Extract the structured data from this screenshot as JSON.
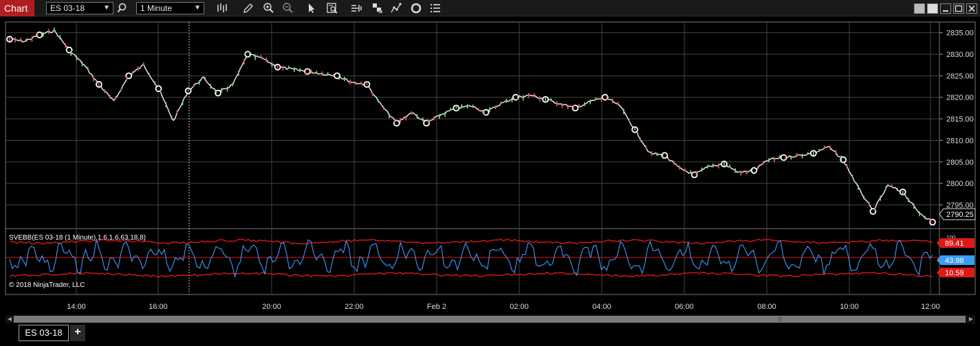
{
  "toolbar": {
    "chart_tab_label": "Chart",
    "instrument": "ES 03-18",
    "interval": "1 Minute",
    "icons": [
      "search-icon",
      "bar-type-icon",
      "pencil-draw-icon",
      "zoom-in-icon",
      "zoom-out-icon",
      "pointer-icon",
      "data-box-icon",
      "strategy-icon",
      "chart-style-icon",
      "drawing-objects-icon",
      "refresh-icon",
      "properties-list-icon"
    ],
    "window_buttons": [
      "window-tile-icon",
      "window-restore-icon",
      "minimize-icon",
      "maximize-icon",
      "close-icon"
    ]
  },
  "price_panel": {
    "y_ticks": [
      "2835.00",
      "2830.00",
      "2825.00",
      "2820.00",
      "2815.00",
      "2810.00",
      "2805.00",
      "2800.00",
      "2795.00"
    ],
    "last_price": "2790.25"
  },
  "indicator_panel": {
    "label": "SVEBB(ES 03-18 (1 Minute),1.6,1.6,63,18,8)",
    "copyright": "© 2018 NinjaTrader, LLC",
    "upper_value": "89.41",
    "mid_value": "43.98",
    "lower_value": "10.59",
    "y_ticks_partial": [
      "100",
      "50",
      "0"
    ]
  },
  "time_axis": {
    "labels": [
      "14:00",
      "16:00",
      "20:00",
      "22:00",
      "Feb 2",
      "02:00",
      "04:00",
      "06:00",
      "08:00",
      "10:00",
      "12:00"
    ]
  },
  "colors": {
    "price_line": "#ffffff",
    "band_color": "#e01818",
    "osc_color": "#3b8fe8",
    "mid_badge": "#3b9cf5",
    "chart_tab": "#b01f1f"
  },
  "chart_data": {
    "type": "line",
    "x": [
      "13:00",
      "13:15",
      "13:30",
      "13:45",
      "14:00",
      "14:15",
      "14:30",
      "14:45",
      "15:00",
      "15:15",
      "15:30",
      "15:45",
      "16:00",
      "16:15",
      "16:30",
      "16:45",
      "17:00",
      "17:15",
      "17:30",
      "17:45",
      "18:00",
      "18:30",
      "19:00",
      "19:30",
      "20:00",
      "20:30",
      "20:45",
      "21:00",
      "21:30",
      "22:00",
      "22:30",
      "23:00",
      "23:30",
      "00:00",
      "00:30",
      "01:00",
      "01:30",
      "02:00",
      "02:30",
      "03:00",
      "03:30",
      "04:00",
      "04:30",
      "05:00",
      "05:30",
      "06:00",
      "06:30",
      "07:00",
      "07:30",
      "08:00",
      "08:30",
      "08:45",
      "09:00",
      "09:30",
      "10:00",
      "10:15",
      "10:30",
      "11:00",
      "11:30",
      "12:00"
    ],
    "series": [
      {
        "values": [
          2833.5,
          2833.0,
          2834.5,
          2835.5,
          2831.0,
          2827.5,
          2823.0,
          2819.0,
          2825.0,
          2827.5,
          2822.0,
          2814.5,
          2821.5,
          2824.5,
          2821.0,
          2823.0,
          2830.0,
          2829.0,
          2827.0,
          2826.5,
          2826.0,
          2825.5,
          2825.0,
          2823.5,
          2823.0,
          2818.0,
          2814.0,
          2816.5,
          2814.0,
          2816.0,
          2817.5,
          2818.0,
          2816.5,
          2818.5,
          2820.0,
          2820.5,
          2819.5,
          2818.5,
          2817.5,
          2819.0,
          2820.0,
          2818.0,
          2812.5,
          2807.0,
          2806.5,
          2803.5,
          2802.0,
          2804.0,
          2804.5,
          2802.5,
          2803.0,
          2805.5,
          2806.0,
          2806.5,
          2807.0,
          2808.5,
          2805.5,
          2799.0,
          2793.5,
          2799.5,
          2798.0,
          2793.5,
          2791.0
        ]
      }
    ],
    "y_ticks": [
      "2835.00",
      "2830.00",
      "2825.00",
      "2820.00",
      "2815.00",
      "2810.00",
      "2805.00",
      "2800.00",
      "2795.00"
    ],
    "ylim": [
      2789.5,
      2837.5
    ],
    "grid": true
  }
}
